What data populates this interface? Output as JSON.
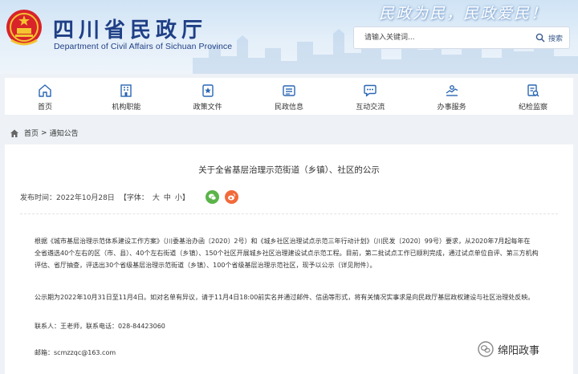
{
  "header": {
    "title": "四川省民政厅",
    "subtitle": "Department of Civil Affairs of Sichuan Province",
    "slogan": "民政为民，民政爱民！",
    "search": {
      "placeholder": "请输入关键词...",
      "button_label": "搜索"
    }
  },
  "nav": {
    "items": [
      {
        "label": "首页",
        "icon": "home-icon"
      },
      {
        "label": "机构职能",
        "icon": "building-icon"
      },
      {
        "label": "政策文件",
        "icon": "document-star-icon"
      },
      {
        "label": "民政信息",
        "icon": "news-icon"
      },
      {
        "label": "互动交流",
        "icon": "chat-icon"
      },
      {
        "label": "办事服务",
        "icon": "service-icon"
      },
      {
        "label": "纪检监察",
        "icon": "inspection-icon"
      }
    ]
  },
  "breadcrumb": {
    "home": "首页",
    "separator": ">",
    "current": "通知公告"
  },
  "article": {
    "title": "关于全省基层治理示范街道（乡镇）、社区的公示",
    "publish_time": "发布时间：2022年10月28日",
    "font_label": "【字体：",
    "font_large": "大",
    "font_medium": "中",
    "font_small": "小",
    "font_close": "】",
    "paragraphs": {
      "p1_l1": "根据《城市基层治理示范体系建设工作方案》（川委基治办函〔2020〕2号）和《城乡社区治理试点示范三年行动计划》（川民发〔2020〕99号）要求，从2020年7月起每年在",
      "p1_l2": "全省遴选40个左右的区（市、县）、40个左右街道（乡镇）、150个社区开展城乡社区治理建设试点示范工程。目前，第二批试点工作已顺利完成，通过试点单位自评、第三方机构",
      "p1_l3": "评估、省厅抽查，评选出30个省级基层治理示范街道（乡镇）、100个省级基层治理示范社区，现予以公示（详见附件）。",
      "p2": "公示期为2022年10月31日至11月4日。如对名单有异议，请于11月4日18:00前实名并通过邮件、信函等形式，将有关情况实事求是向民政厅基层政权建设与社区治理处反映。",
      "p3": "联系人：王老师，联系电话：028-84423060",
      "p4": "邮箱：scmzzqc@163.com"
    }
  },
  "watermark": {
    "label": "绵阳政事"
  },
  "colors": {
    "brand": "#1f3f86",
    "nav_icon": "#2a66b3",
    "wechat": "#5bb44a",
    "weibo": "#f26a3a"
  }
}
